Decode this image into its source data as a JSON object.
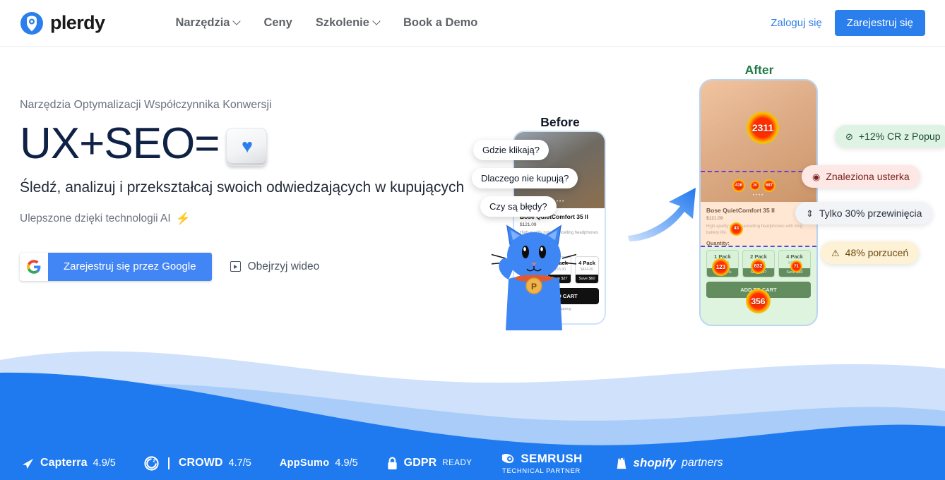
{
  "header": {
    "brand": "plerdy",
    "brand_icon": "plerdy-logo-icon",
    "nav": [
      {
        "label": "Narzędzia",
        "has_dropdown": true
      },
      {
        "label": "Ceny",
        "has_dropdown": false
      },
      {
        "label": "Szkolenie",
        "has_dropdown": true
      },
      {
        "label": "Book a Demo",
        "has_dropdown": false
      }
    ],
    "login_label": "Zaloguj się",
    "signup_label": "Zarejestruj się",
    "accent_color": "#2b7fec"
  },
  "hero": {
    "eyebrow": "Narzędzia Optymalizacji Współczynnika Konwersji",
    "headline": "UX+SEO=",
    "headline_key_icon": "heart-key-icon",
    "heart_glyph": "♥",
    "subhead": "Śledź, analizuj i przekształcaj swoich odwiedzających w kupujących",
    "ai_note": "Ulepszone dzięki technologii AI",
    "ai_icon": "lightning-bolt-icon",
    "ai_glyph": "⚡",
    "google_cta": "Zarejestruj się przez Google",
    "google_icon": "google-g-icon",
    "video_cta": "Obejrzyj wideo",
    "video_icon": "play-button-icon",
    "headline_color": "#0f2246"
  },
  "comparison": {
    "before_label": "Before",
    "after_label": "After",
    "after_label_color": "#1f7a46",
    "arrow_icon": "curved-arrow-icon",
    "mascot_icon": "plerdy-cat-mascot-icon",
    "mascot_badge": "P",
    "before_tips": [
      "Gdzie klikają?",
      "Dlaczego nie kupują?",
      "Czy są błędy?"
    ],
    "product": {
      "title": "Bose QuietComfort 35 II",
      "price": "$121.09",
      "description": "High-quality noise cancelling headphones with long battery life.",
      "quantity_label": "Quantity:",
      "packs": [
        {
          "name": "1 Pack",
          "price": "$121.09",
          "save": "Save 50%"
        },
        {
          "name": "2 Pack",
          "price": "$215.00",
          "save": "Save $27"
        },
        {
          "name": "4 Pack",
          "price": "$424.00",
          "save": "Save $60"
        }
      ],
      "cart_label": "ADD TO CART",
      "shipping_note": "Free shipping",
      "dots": "••••"
    },
    "heat_values": {
      "hero_click": "2311",
      "mini_left": "416",
      "mini_center": "20",
      "mini_right": "687",
      "desc_click": "43",
      "pack1": "123",
      "pack2": "832",
      "pack4": "71",
      "cart_click": "356"
    }
  },
  "badges": [
    {
      "icon": "check-circle-icon",
      "glyph": "⊘",
      "text": "+12% CR z Popup",
      "bg": "#dff3e4",
      "fg": "#1b4d2e"
    },
    {
      "icon": "bug-alert-icon",
      "glyph": "◉",
      "text": "Znaleziona usterka",
      "bg": "#fde8e6",
      "fg": "#7a2420"
    },
    {
      "icon": "scroll-depth-icon",
      "glyph": "⇕",
      "text": "Tylko 30% przewinięcia",
      "bg": "#f1f3f6",
      "fg": "#27313f"
    },
    {
      "icon": "warning-triangle-icon",
      "glyph": "⚠",
      "text": "48% porzuceń",
      "bg": "#fdf1d6",
      "fg": "#6b4a11"
    }
  ],
  "footer": {
    "bg_color": "#1f7af0",
    "logos": [
      {
        "id": "capterra",
        "icon": "capterra-arrow-icon",
        "name": "Capterra",
        "score": "4.9/5"
      },
      {
        "id": "g2crowd",
        "icon": "g2-icon",
        "name": "CROWD",
        "score": "4.7/5"
      },
      {
        "id": "appsumo",
        "icon": "appsumo-icon",
        "name": "AppSumo",
        "score": "4.9/5"
      },
      {
        "id": "gdpr",
        "icon": "lock-icon",
        "name": "GDPR",
        "score": "READY"
      },
      {
        "id": "semrush",
        "icon": "semrush-icon",
        "name": "SEMRUSH",
        "sub": "TECHNICAL PARTNER"
      },
      {
        "id": "shopify",
        "icon": "shopify-bag-icon",
        "name": "shopify",
        "sub": "partners"
      }
    ]
  }
}
